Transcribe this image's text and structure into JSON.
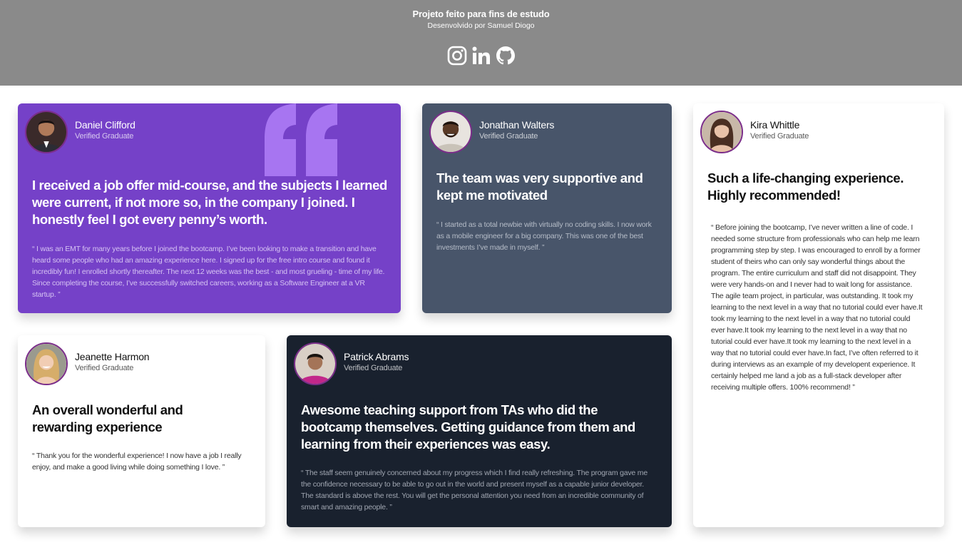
{
  "header": {
    "title": "Projeto feito para fins de estudo",
    "subtitle": "Desenvolvido por Samuel Diogo",
    "socials": [
      "instagram-icon",
      "linkedin-icon",
      "github-icon"
    ]
  },
  "colors": {
    "header_bg": "#8a8a8a",
    "purple": "#7541c8",
    "slate": "#48556a",
    "dark": "#19212e",
    "avatar_ring": "#7b2d8a"
  },
  "testimonials": [
    {
      "name": "Daniel Clifford",
      "role": "Verified Graduate",
      "headline": "I received a job offer mid-course, and the subjects I learned were current, if not more so, in the company I joined. I honestly feel I got every penny’s worth.",
      "quote": "“ I was an EMT for many years before I joined the bootcamp. I’ve been looking to make a transition and have heard some people who had an amazing experience here. I signed up for the free intro course and found it incredibly fun! I enrolled shortly thereafter. The next 12 weeks was the best - and most grueling - time of my life. Since completing the course, I’ve successfully switched careers, working as a Software Engineer at a VR startup. ”"
    },
    {
      "name": "Jonathan Walters",
      "role": "Verified Graduate",
      "headline": "The team was very supportive and kept me motivated",
      "quote": "“ I started as a total newbie with virtually no coding skills. I now work as a mobile engineer for a big company. This was one of the best investments I’ve made in myself. ”"
    },
    {
      "name": "Kira Whittle",
      "role": "Verified Graduate",
      "headline": "Such a life-changing experience. Highly recommended!",
      "quote": "“ Before joining the bootcamp, I’ve never written a line of code. I needed some structure from professionals who can help me learn programming step by step. I was encouraged to enroll by a former student of theirs who can only say wonderful things about the program. The entire curriculum and staff did not disappoint. They were very hands-on and I never had to wait long for assistance. The agile team project, in particular, was outstanding. It took my learning to the next level in a way that no tutorial could ever have.It took my learning to the next level in a way that no tutorial could ever have.It took my learning to the next level in a way that no tutorial could ever have.It took my learning to the next level in a way that no tutorial could ever have.In fact, I’ve often referred to it during interviews as an example of my developent experience. It certainly helped me land a job as a full-stack developer after receiving multiple offers. 100% recommend! ”"
    },
    {
      "name": "Jeanette Harmon",
      "role": "Verified Graduate",
      "headline": "An overall wonderful and rewarding experience",
      "quote": "“ Thank you for the wonderful experience! I now have a job I really enjoy, and make a good living while doing something I love. ”"
    },
    {
      "name": "Patrick Abrams",
      "role": "Verified Graduate",
      "headline": "Awesome teaching support from TAs who did the bootcamp themselves. Getting guidance from them and learning from their experiences was easy.",
      "quote": "“ The staff seem genuinely concerned about my progress which I find really refreshing. The program gave me the confidence necessary to be able to go out in the world and present myself as a capable junior developer. The standard is above the rest. You will get the personal attention you need from an incredible community of smart and amazing people. ”"
    }
  ]
}
